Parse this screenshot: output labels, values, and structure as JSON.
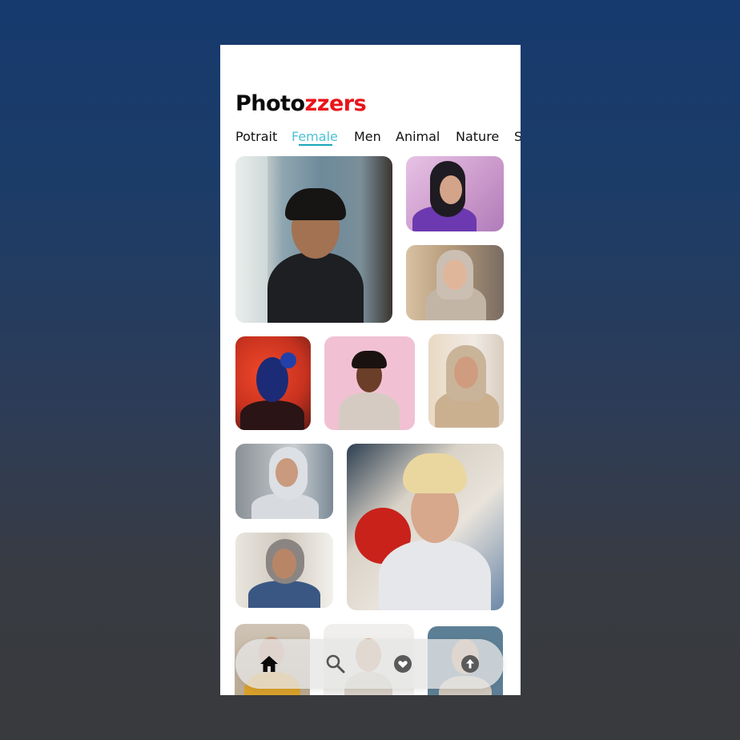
{
  "app": {
    "brand_part1": "Photo",
    "brand_part2": "zzers",
    "brand_color_primary": "#0b0b0b",
    "brand_color_accent": "#e8141b"
  },
  "tabs": [
    {
      "label": "Potrait",
      "active": false
    },
    {
      "label": "Female",
      "active": true
    },
    {
      "label": "Men",
      "active": false
    },
    {
      "label": "Animal",
      "active": false
    },
    {
      "label": "Nature",
      "active": false
    },
    {
      "label": "S",
      "active": false
    }
  ],
  "accent_color": "#4cc3d2",
  "bottom_nav": [
    {
      "icon": "home-icon",
      "active": true
    },
    {
      "icon": "search-icon",
      "active": false
    },
    {
      "icon": "heart-icon",
      "active": false
    },
    {
      "icon": "upload-icon",
      "active": false
    }
  ]
}
